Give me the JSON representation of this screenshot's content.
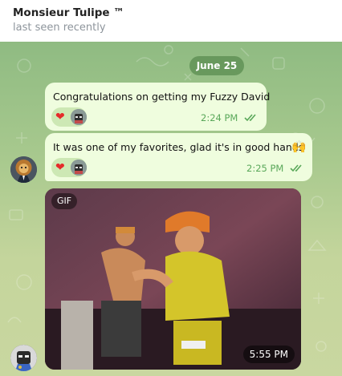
{
  "header": {
    "title": "Monsieur Tulipe ™",
    "status": "last seen recently"
  },
  "date_separator": "June 25",
  "messages": [
    {
      "text": "Congratulations on getting my Fuzzy David",
      "time": "2:24 PM",
      "reactions": [
        "heart",
        "avatar"
      ],
      "read": true
    },
    {
      "text": "It was one of my favorites, glad it's in good hands",
      "emoji": "🙌",
      "time": "2:25 PM",
      "reactions": [
        "heart",
        "avatar"
      ],
      "read": true
    }
  ],
  "gif": {
    "badge": "GIF",
    "time": "5:55 PM"
  },
  "colors": {
    "bubble": "#effdde",
    "accent_green": "#5aa85a",
    "heart": "#e52a2a",
    "wallpaper_top": "#8fbb82",
    "wallpaper_bottom": "#c9d7a0"
  },
  "heart_glyph": "❤"
}
